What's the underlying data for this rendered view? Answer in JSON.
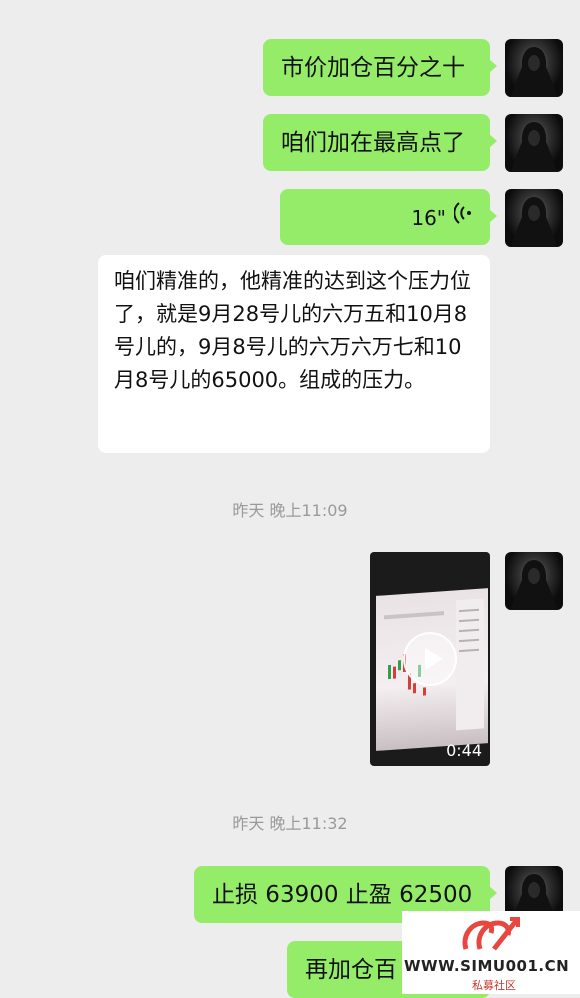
{
  "messages": {
    "m1": "市价加仓百分之十",
    "m2": "咱们加在最高点了",
    "voice": "16\"",
    "other_text": "咱们精准的，他精准的达到这个压力位了，就是9月28号儿的六万五和10月8号儿的，9月8号儿的六万六万七和10月8号儿的65000。组成的压力。",
    "ts1": "昨天 晚上11:09",
    "video_duration": "0:44",
    "ts2": "昨天 晚上11:32",
    "m3": "止损 63900 止盈 62500",
    "m4": "再加仓百"
  },
  "watermark": {
    "url": "WWW.SIMU001.CN",
    "sub": "私募社区"
  },
  "colors": {
    "self_bubble": "#95ec69",
    "other_bubble": "#ffffff",
    "background": "#ededed",
    "watermark_logo": "#e8473f"
  },
  "icons": [
    "voice-wave-icon",
    "play-icon",
    "logo-icon"
  ]
}
